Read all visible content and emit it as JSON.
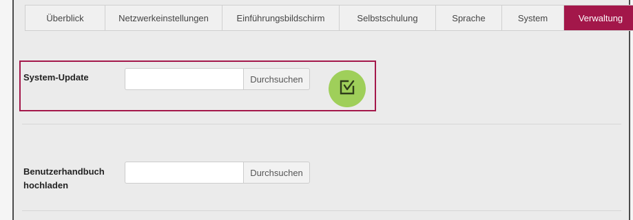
{
  "tabs": [
    {
      "label": "Überblick",
      "active": false
    },
    {
      "label": "Netzwerkeinstellungen",
      "active": false
    },
    {
      "label": "Einführungsbildschirm",
      "active": false
    },
    {
      "label": "Selbstschulung",
      "active": false
    },
    {
      "label": "Sprache",
      "active": false
    },
    {
      "label": "System",
      "active": false
    },
    {
      "label": "Verwaltung",
      "active": true
    }
  ],
  "system_update": {
    "label": "System-Update",
    "file_value": "",
    "browse_label": "Durchsuchen",
    "submit_icon": "edit-check-icon"
  },
  "manual_upload": {
    "label_line1": "Benutzerhandbuch",
    "label_line2": "hochladen",
    "file_value": "",
    "browse_label": "Durchsuchen"
  },
  "colors": {
    "accent": "#a3174a",
    "submit": "#9fcf5a"
  }
}
